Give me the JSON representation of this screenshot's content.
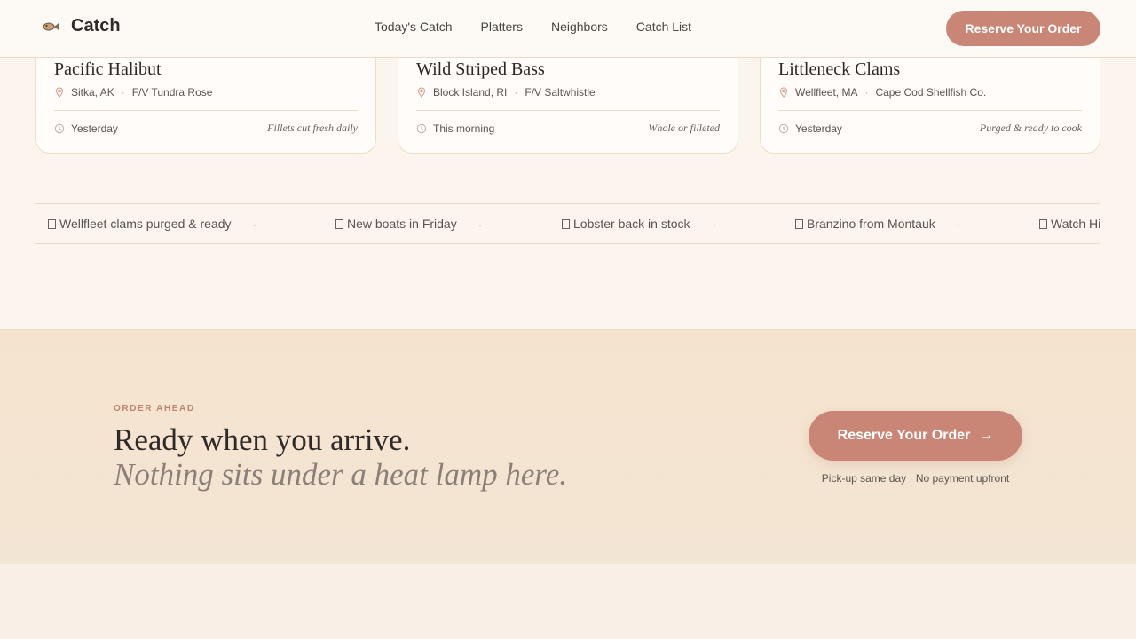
{
  "header": {
    "logo_text": "Catch",
    "nav": [
      "Today's Catch",
      "Platters",
      "Neighbors",
      "Catch List"
    ],
    "cta_label": "Reserve Your Order"
  },
  "cards": [
    {
      "title": "Pacific Halibut",
      "location": "Sitka, AK",
      "vessel": "F/V Tundra Rose",
      "when": "Yesterday",
      "note": "Fillets cut fresh daily"
    },
    {
      "title": "Wild Striped Bass",
      "location": "Block Island, RI",
      "vessel": "F/V Saltwhistle",
      "when": "This morning",
      "note": "Whole or filleted"
    },
    {
      "title": "Littleneck Clams",
      "location": "Wellfleet, MA",
      "vessel": "Cape Cod Shellfish Co.",
      "when": "Yesterday",
      "note": "Purged & ready to cook"
    }
  ],
  "ticker": [
    "Wellfleet clams purged & ready",
    "New boats in Friday",
    "Lobster back in stock",
    "Branzino from Montauk",
    "Watch Hi"
  ],
  "order_ahead": {
    "eyebrow": "ORDER AHEAD",
    "title": "Ready when you arrive.",
    "subtitle": "Nothing sits under a heat lamp here.",
    "cta_label": "Reserve Your Order",
    "cta_arrow": "→",
    "note": "Pick-up same day · No payment upfront"
  },
  "colors": {
    "accent": "#c98676",
    "background": "#fbf5ee",
    "band": "#f4e4cf"
  },
  "icons": {
    "logo": "fish-icon",
    "location": "map-pin-icon",
    "time": "clock-icon",
    "ticker": "box-icon"
  }
}
